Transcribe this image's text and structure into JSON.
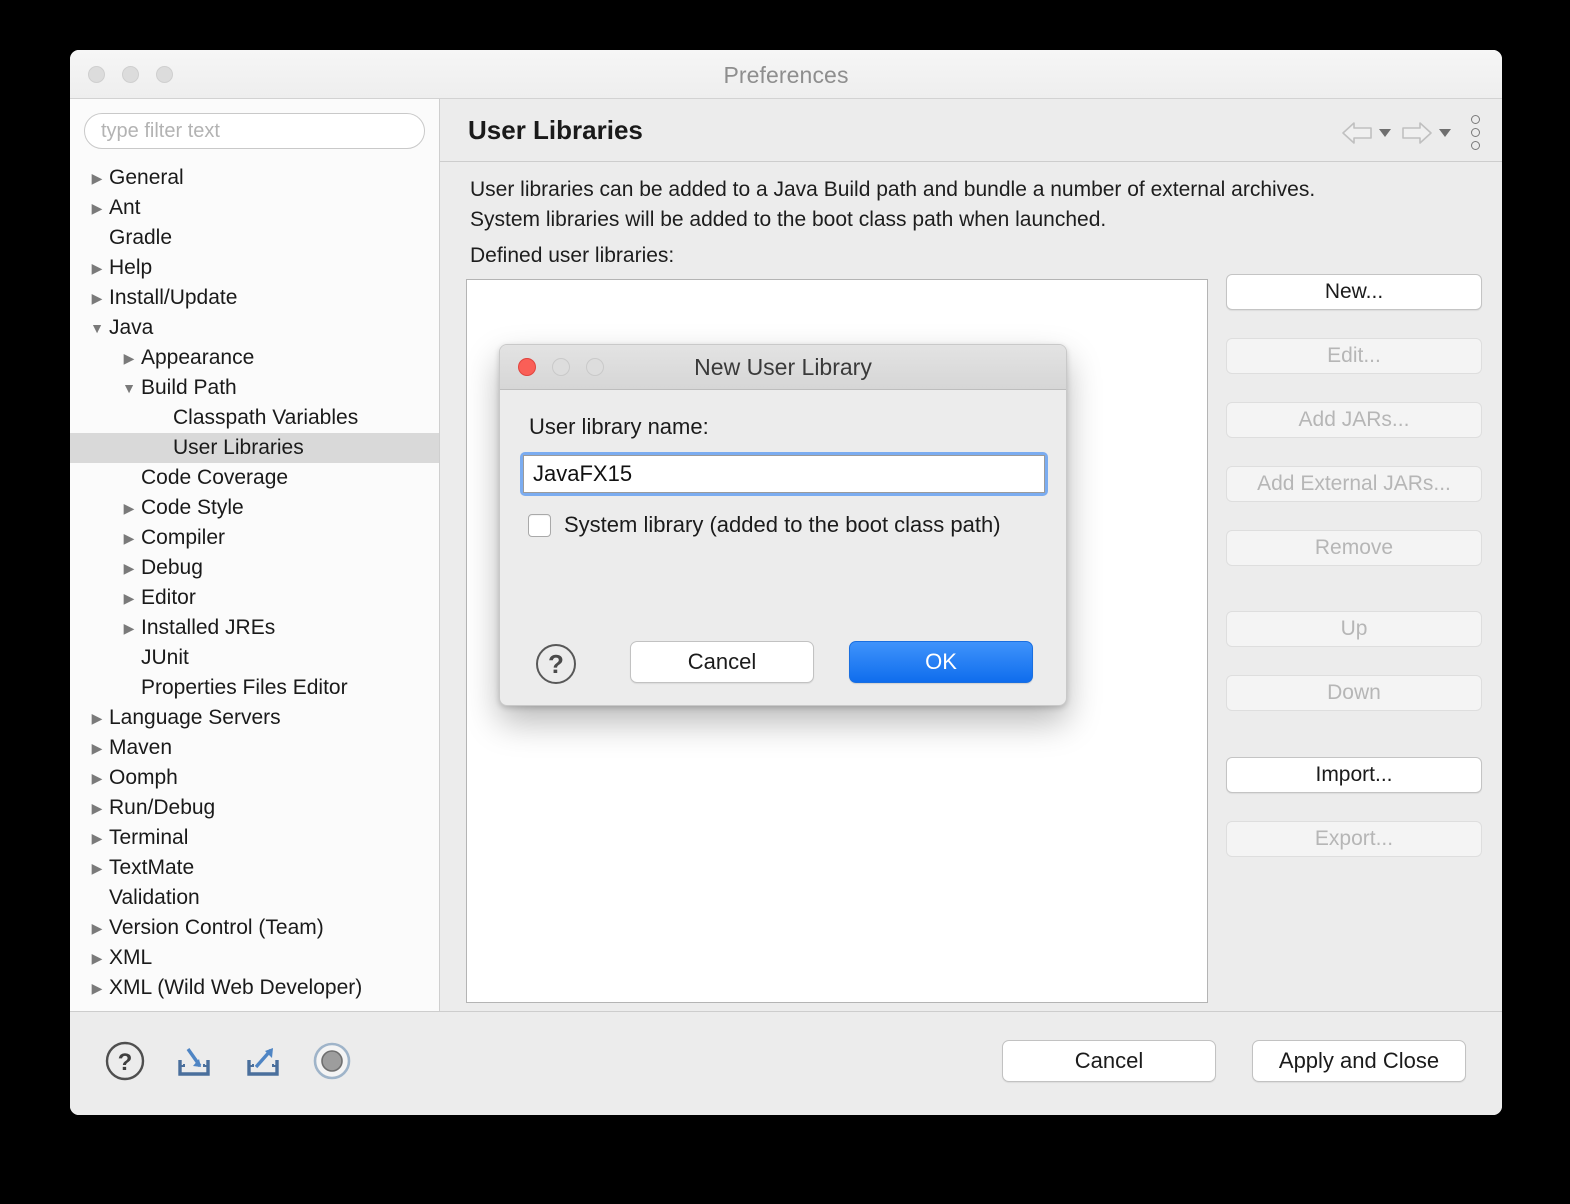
{
  "window": {
    "title": "Preferences",
    "traffic_lights": [
      "close",
      "minimize",
      "maximize"
    ]
  },
  "sidebar": {
    "filter": {
      "placeholder": "type filter text",
      "value": ""
    },
    "items": [
      {
        "label": "General",
        "indent": 0,
        "twisty": "collapsed",
        "selected": false
      },
      {
        "label": "Ant",
        "indent": 0,
        "twisty": "collapsed",
        "selected": false
      },
      {
        "label": "Gradle",
        "indent": 0,
        "twisty": "none",
        "selected": false
      },
      {
        "label": "Help",
        "indent": 0,
        "twisty": "collapsed",
        "selected": false
      },
      {
        "label": "Install/Update",
        "indent": 0,
        "twisty": "collapsed",
        "selected": false
      },
      {
        "label": "Java",
        "indent": 0,
        "twisty": "expanded",
        "selected": false
      },
      {
        "label": "Appearance",
        "indent": 1,
        "twisty": "collapsed",
        "selected": false
      },
      {
        "label": "Build Path",
        "indent": 1,
        "twisty": "expanded",
        "selected": false
      },
      {
        "label": "Classpath Variables",
        "indent": 2,
        "twisty": "none",
        "selected": false
      },
      {
        "label": "User Libraries",
        "indent": 2,
        "twisty": "none",
        "selected": true
      },
      {
        "label": "Code Coverage",
        "indent": 1,
        "twisty": "none",
        "selected": false
      },
      {
        "label": "Code Style",
        "indent": 1,
        "twisty": "collapsed",
        "selected": false
      },
      {
        "label": "Compiler",
        "indent": 1,
        "twisty": "collapsed",
        "selected": false
      },
      {
        "label": "Debug",
        "indent": 1,
        "twisty": "collapsed",
        "selected": false
      },
      {
        "label": "Editor",
        "indent": 1,
        "twisty": "collapsed",
        "selected": false
      },
      {
        "label": "Installed JREs",
        "indent": 1,
        "twisty": "collapsed",
        "selected": false
      },
      {
        "label": "JUnit",
        "indent": 1,
        "twisty": "none",
        "selected": false
      },
      {
        "label": "Properties Files Editor",
        "indent": 1,
        "twisty": "none",
        "selected": false
      },
      {
        "label": "Language Servers",
        "indent": 0,
        "twisty": "collapsed",
        "selected": false
      },
      {
        "label": "Maven",
        "indent": 0,
        "twisty": "collapsed",
        "selected": false
      },
      {
        "label": "Oomph",
        "indent": 0,
        "twisty": "collapsed",
        "selected": false
      },
      {
        "label": "Run/Debug",
        "indent": 0,
        "twisty": "collapsed",
        "selected": false
      },
      {
        "label": "Terminal",
        "indent": 0,
        "twisty": "collapsed",
        "selected": false
      },
      {
        "label": "TextMate",
        "indent": 0,
        "twisty": "collapsed",
        "selected": false
      },
      {
        "label": "Validation",
        "indent": 0,
        "twisty": "none",
        "selected": false
      },
      {
        "label": "Version Control (Team)",
        "indent": 0,
        "twisty": "collapsed",
        "selected": false
      },
      {
        "label": "XML",
        "indent": 0,
        "twisty": "collapsed",
        "selected": false
      },
      {
        "label": "XML (Wild Web Developer)",
        "indent": 0,
        "twisty": "collapsed",
        "selected": false
      }
    ]
  },
  "content": {
    "page_title": "User Libraries",
    "nav": {
      "back_icon": "back-arrow-icon",
      "forward_icon": "forward-arrow-icon",
      "menu_icon": "view-menu-icon"
    },
    "description_line1": "User libraries can be added to a Java Build path and bundle a number of external archives.",
    "description_line2": "System libraries will be added to the boot class path when launched.",
    "defined_label": "Defined user libraries:",
    "library_items": [],
    "side_buttons": [
      {
        "label": "New...",
        "enabled": true,
        "gap": "none"
      },
      {
        "label": "Edit...",
        "enabled": false,
        "gap": "sm"
      },
      {
        "label": "Add JARs...",
        "enabled": false,
        "gap": "sm"
      },
      {
        "label": "Add External JARs...",
        "enabled": false,
        "gap": "sm"
      },
      {
        "label": "Remove",
        "enabled": false,
        "gap": "sm"
      },
      {
        "label": "Up",
        "enabled": false,
        "gap": "md"
      },
      {
        "label": "Down",
        "enabled": false,
        "gap": "sm"
      },
      {
        "label": "Import...",
        "enabled": true,
        "gap": "lg"
      },
      {
        "label": "Export...",
        "enabled": false,
        "gap": "sm"
      }
    ]
  },
  "bottom_bar": {
    "icons": [
      "help-icon",
      "import-icon",
      "export-icon",
      "restore-defaults-icon"
    ],
    "cancel_label": "Cancel",
    "apply_label": "Apply and Close"
  },
  "modal": {
    "title": "New User Library",
    "traffic_lights": [
      "close",
      "minimize",
      "maximize"
    ],
    "field_label": "User library name:",
    "name_value": "JavaFX15",
    "name_placeholder": "",
    "checkbox_label": "System library (added to the boot class path)",
    "checkbox_checked": false,
    "help_glyph": "?",
    "cancel_label": "Cancel",
    "ok_label": "OK"
  },
  "colors": {
    "accent_blue": "#0f6ded",
    "focus_ring": "#7bacf0",
    "close_red": "#fa5f57",
    "selection_gray": "#d9d9d9",
    "window_bg": "#ececec"
  }
}
